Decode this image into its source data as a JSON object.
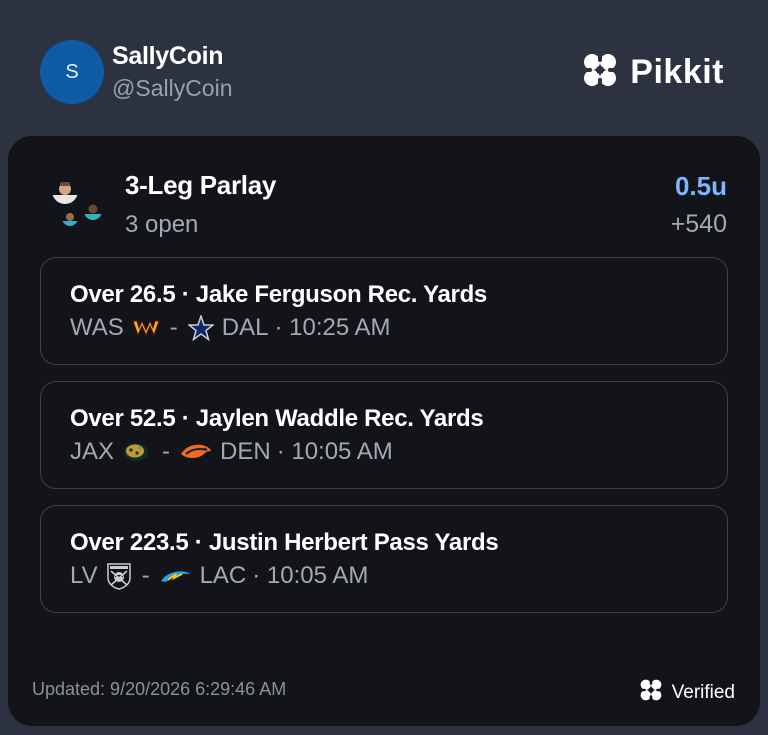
{
  "user": {
    "avatar_letter": "S",
    "name": "SallyCoin",
    "handle": "@SallyCoin"
  },
  "brand": {
    "name": "Pikkit",
    "icon": "clover-icon"
  },
  "bet": {
    "title": "3-Leg Parlay",
    "status": "3 open",
    "units": "0.5u",
    "odds": "+540",
    "units_color": "#7fb5ff"
  },
  "legs": [
    {
      "title": "Over 26.5 · Jake Ferguson Rec. Yards",
      "away": "WAS",
      "away_logo": "commanders-logo",
      "separator": "-",
      "home": "DAL",
      "home_logo": "cowboys-logo",
      "time": "· 10:25 AM"
    },
    {
      "title": "Over 52.5 · Jaylen Waddle Rec. Yards",
      "away": "JAX",
      "away_logo": "jaguars-logo",
      "separator": "-",
      "home": "DEN",
      "home_logo": "broncos-logo",
      "time": "· 10:05 AM"
    },
    {
      "title": "Over 223.5 · Justin Herbert Pass Yards",
      "away": "LV",
      "away_logo": "raiders-logo",
      "separator": "-",
      "home": "LAC",
      "home_logo": "chargers-logo",
      "time": "· 10:05 AM"
    }
  ],
  "footer": {
    "updated": "Updated: 9/20/2026 6:29:46 AM",
    "verified": "Verified"
  }
}
